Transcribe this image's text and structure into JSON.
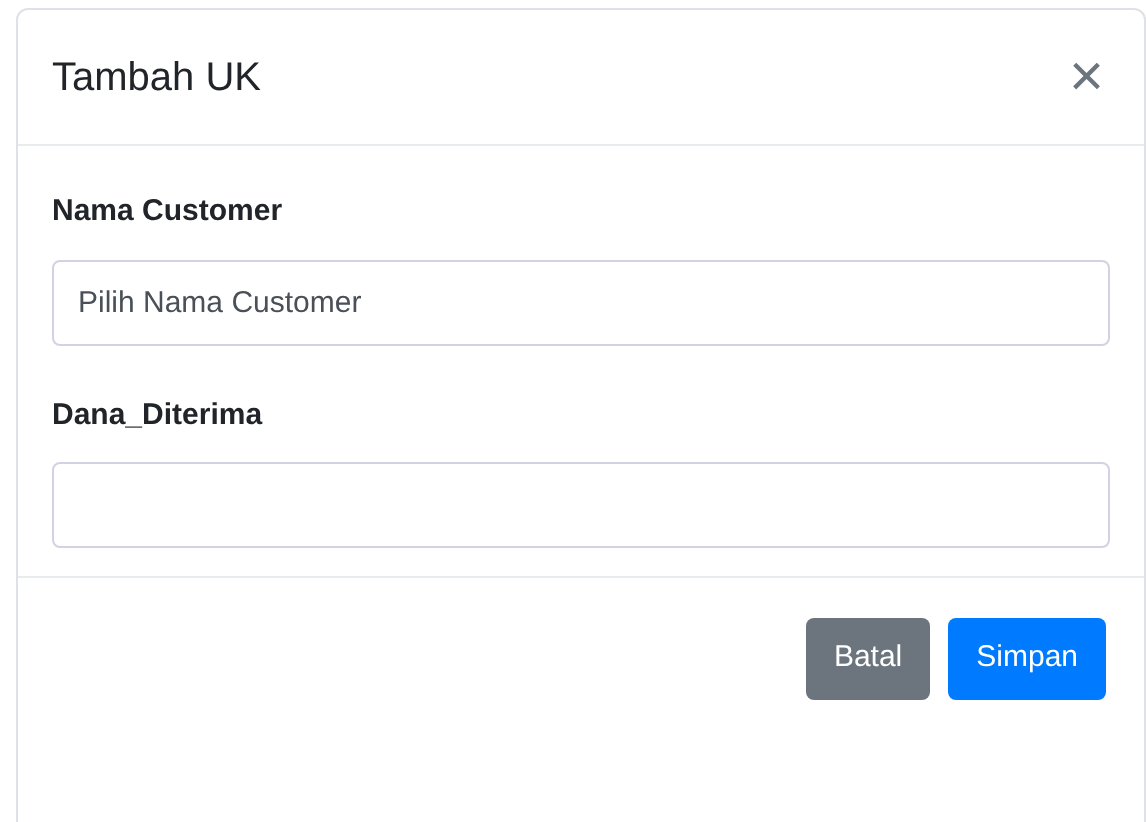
{
  "modal": {
    "title": "Tambah UK",
    "close_icon": "×",
    "fields": [
      {
        "label": "Nama Customer",
        "placeholder": "Pilih Nama Customer"
      },
      {
        "label": "Dana_Diterima"
      }
    ],
    "buttons": [
      {
        "label": "Batal",
        "kind": "secondary"
      },
      {
        "label": "Simpan",
        "kind": "primary"
      }
    ]
  }
}
